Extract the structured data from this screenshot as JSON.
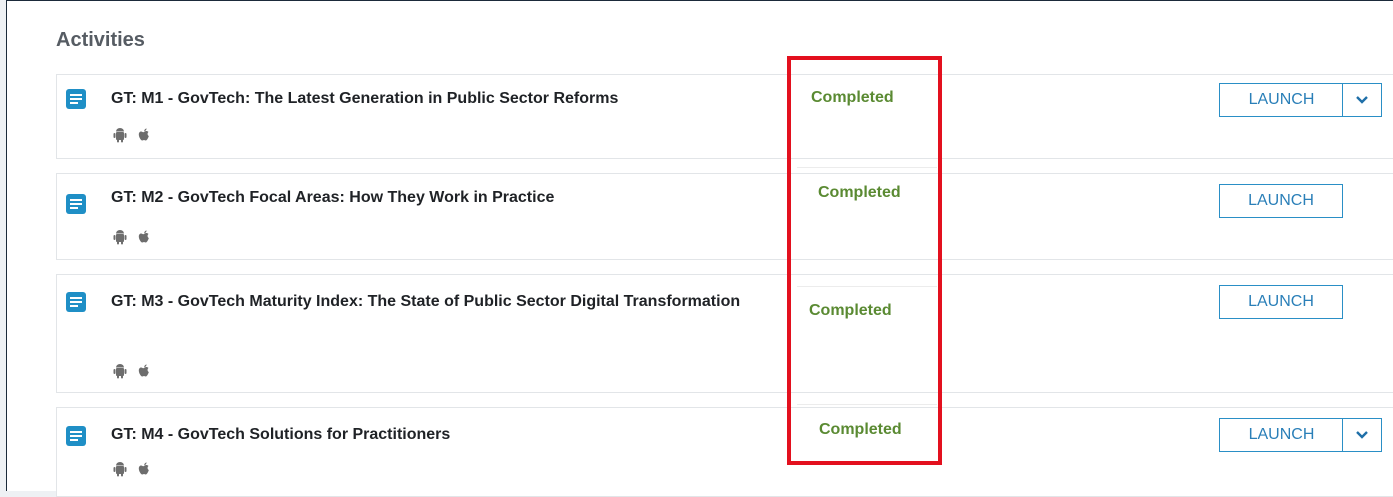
{
  "section": {
    "title": "Activities"
  },
  "colors": {
    "accent": "#2a8fc6",
    "status_completed": "#5a8a32",
    "highlight": "#e3101e",
    "doc_icon": "#1f8fc6"
  },
  "activities": [
    {
      "title": "GT: M1 - GovTech: The Latest Generation in Public Sector Reforms",
      "status": "Completed",
      "launch_label": "LAUNCH",
      "has_dropdown": true,
      "platforms": [
        "android-icon",
        "apple-icon"
      ]
    },
    {
      "title": "GT: M2 - GovTech Focal Areas: How They Work in Practice",
      "status": "Completed",
      "launch_label": "LAUNCH",
      "has_dropdown": false,
      "platforms": [
        "android-icon",
        "apple-icon"
      ]
    },
    {
      "title": "GT: M3 - GovTech Maturity Index: The State of Public Sector Digital Transformation",
      "status": "Completed",
      "launch_label": "LAUNCH",
      "has_dropdown": false,
      "platforms": [
        "android-icon",
        "apple-icon"
      ]
    },
    {
      "title": "GT: M4 - GovTech Solutions for Practitioners",
      "status": "Completed",
      "launch_label": "LAUNCH",
      "has_dropdown": true,
      "platforms": [
        "android-icon",
        "apple-icon"
      ]
    }
  ]
}
